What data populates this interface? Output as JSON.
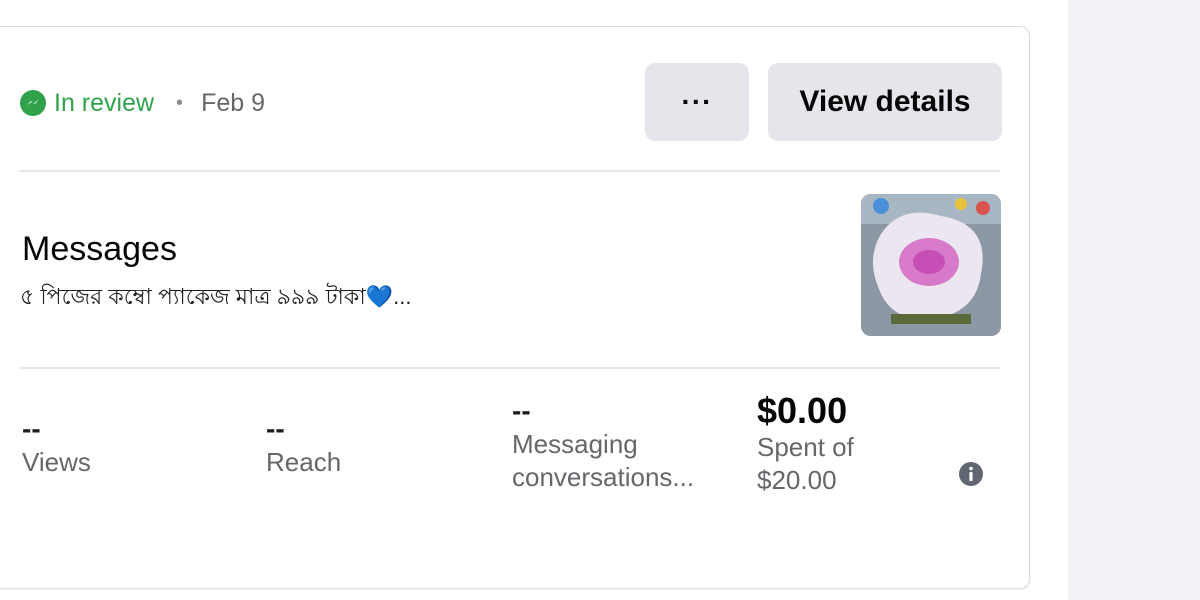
{
  "status": {
    "icon": "messenger-icon",
    "label": "In review",
    "separator": "•",
    "date": "Feb 9",
    "color": "#31a24c"
  },
  "actions": {
    "more_label": "···",
    "view_details_label": "View details"
  },
  "ad": {
    "title": "Messages",
    "text": "৫ পিজের কম্বো প্যাকেজ মাত্র ৯৯৯ টাকা💙..."
  },
  "metrics": [
    {
      "value": "--",
      "label": "Views"
    },
    {
      "value": "--",
      "label": "Reach"
    },
    {
      "value": "--",
      "label": "Messaging conversations..."
    },
    {
      "value": "$0.00",
      "label_line1": "Spent of",
      "label_line2": "$20.00"
    }
  ],
  "info_icon": "info-icon"
}
